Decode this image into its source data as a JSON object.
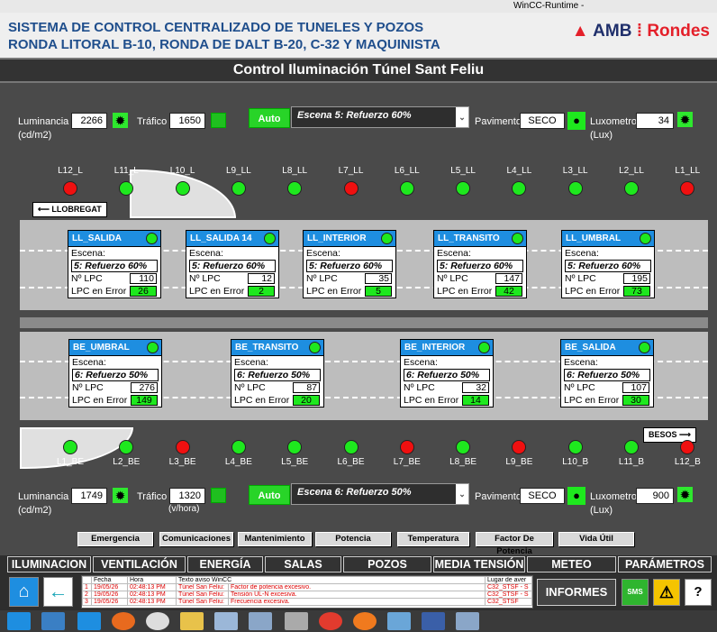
{
  "window": {
    "title": "WinCC-Runtime -"
  },
  "header": {
    "line1": "SISTEMA DE CONTROL CENTRALIZADO DE TUNELES Y POZOS",
    "line2": "RONDA LITORAL B-10, RONDA DE DALT B-20, C-32 Y MAQUINISTA",
    "logo_amb": "AMB",
    "logo_sep": "⁞",
    "logo_rondes": "Rondes"
  },
  "page_title": "Control Iluminación Túnel Sant Feliu",
  "top_controls": {
    "luminancia_label": "Luminancia",
    "luminancia_unit": "(cd/m2)",
    "luminancia_value": "2266",
    "trafico_label": "Tráfico",
    "trafico_value": "1650",
    "auto_label": "Auto",
    "escena_value": "Escena 5: Refuerzo 60%",
    "pavimento_label": "Pavimento",
    "pavimento_value": "SECO",
    "luxometro_label": "Luxometro",
    "luxometro_unit": "(Lux)",
    "luxometro_value": "34"
  },
  "bottom_controls": {
    "luminancia_label": "Luminancia",
    "luminancia_unit": "(cd/m2)",
    "luminancia_value": "1749",
    "trafico_label": "Tráfico",
    "trafico_unit": "(v/hora)",
    "trafico_value": "1320",
    "auto_label": "Auto",
    "escena_value": "Escena 6: Refuerzo 50%",
    "pavimento_label": "Pavimento",
    "pavimento_value": "SECO",
    "luxometro_label": "Luxometro",
    "luxometro_unit": "(Lux)",
    "luxometro_value": "900"
  },
  "lamps_top": [
    {
      "label": "L12_L",
      "status": "red"
    },
    {
      "label": "L11_L",
      "status": "green"
    },
    {
      "label": "L10_L",
      "status": "green"
    },
    {
      "label": "L9_LL",
      "status": "green"
    },
    {
      "label": "L8_LL",
      "status": "green"
    },
    {
      "label": "L7_LL",
      "status": "red"
    },
    {
      "label": "L6_LL",
      "status": "green"
    },
    {
      "label": "L5_LL",
      "status": "green"
    },
    {
      "label": "L4_LL",
      "status": "green"
    },
    {
      "label": "L3_LL",
      "status": "green"
    },
    {
      "label": "L2_LL",
      "status": "green"
    },
    {
      "label": "L1_LL",
      "status": "red"
    }
  ],
  "lamps_bottom": [
    {
      "label": "L1_BE",
      "status": "green"
    },
    {
      "label": "L2_BE",
      "status": "green"
    },
    {
      "label": "L3_BE",
      "status": "red"
    },
    {
      "label": "L4_BE",
      "status": "green"
    },
    {
      "label": "L5_BE",
      "status": "green"
    },
    {
      "label": "L6_BE",
      "status": "green"
    },
    {
      "label": "L7_BE",
      "status": "red"
    },
    {
      "label": "L8_BE",
      "status": "green"
    },
    {
      "label": "L9_BE",
      "status": "red"
    },
    {
      "label": "L10_B",
      "status": "green"
    },
    {
      "label": "L11_B",
      "status": "green"
    },
    {
      "label": "L12_B",
      "status": "red"
    }
  ],
  "direction": {
    "llobregat": "LLOBREGAT",
    "besos": "BESOS"
  },
  "panel_labels": {
    "escena": "Escena:",
    "nlpc": "Nº LPC",
    "error": "LPC en Error"
  },
  "panels_top": [
    {
      "title": "LL_SALIDA",
      "escena": "5: Refuerzo 60%",
      "nlpc": "110",
      "error": "26"
    },
    {
      "title": "LL_SALIDA 14",
      "escena": "5: Refuerzo 60%",
      "nlpc": "12",
      "error": "2"
    },
    {
      "title": "LL_INTERIOR",
      "escena": "5: Refuerzo 60%",
      "nlpc": "35",
      "error": "5"
    },
    {
      "title": "LL_TRANSITO",
      "escena": "5: Refuerzo 60%",
      "nlpc": "147",
      "error": "42"
    },
    {
      "title": "LL_UMBRAL",
      "escena": "5: Refuerzo 60%",
      "nlpc": "195",
      "error": "73"
    }
  ],
  "panels_bottom": [
    {
      "title": "BE_UMBRAL",
      "escena": "6: Refuerzo 50%",
      "nlpc": "276",
      "error": "149"
    },
    {
      "title": "BE_TRANSITO",
      "escena": "6: Refuerzo 50%",
      "nlpc": "87",
      "error": "20"
    },
    {
      "title": "BE_INTERIOR",
      "escena": "6: Refuerzo 50%",
      "nlpc": "32",
      "error": "14"
    },
    {
      "title": "BE_SALIDA",
      "escena": "6: Refuerzo 50%",
      "nlpc": "107",
      "error": "30"
    }
  ],
  "categories": [
    "Emergencia",
    "Comunicaciones",
    "Mantenimiento",
    "Potencia",
    "Temperatura",
    "Factor De Potencia",
    "Vida Útil"
  ],
  "nav": [
    "ILUMINACION",
    "VENTILACIÓN",
    "ENERGÍA",
    "SALAS",
    "POZOS",
    "MEDIA TENSIÓN",
    "METEO",
    "PARÁMETROS"
  ],
  "alarm_table": {
    "headers": [
      "",
      "Fecha",
      "Hora",
      "Texto aviso WinCC",
      "Lugar de aver"
    ],
    "rows": [
      [
        "1",
        "19/05/26",
        "02:48:13 PM",
        "Túnel San Feliu:",
        "Factor de potencia excesivo.",
        "C32_STSF - S"
      ],
      [
        "2",
        "19/05/26",
        "02:48:13 PM",
        "Túnel San Feliu:",
        "Tensión UL-N excesiva.",
        "C32_STSF - S"
      ],
      [
        "3",
        "19/05/26",
        "02:48:13 PM",
        "Túnel San Feliu:",
        "Frecuencia excesiva.",
        "C32_STSF"
      ]
    ]
  },
  "buttons": {
    "informes": "INFORMES",
    "sms": "SMS",
    "help": "?"
  },
  "colors": {
    "panel_header": "#1e8ee0",
    "ok_green": "#1ee81e",
    "fault_red": "#f01010"
  }
}
